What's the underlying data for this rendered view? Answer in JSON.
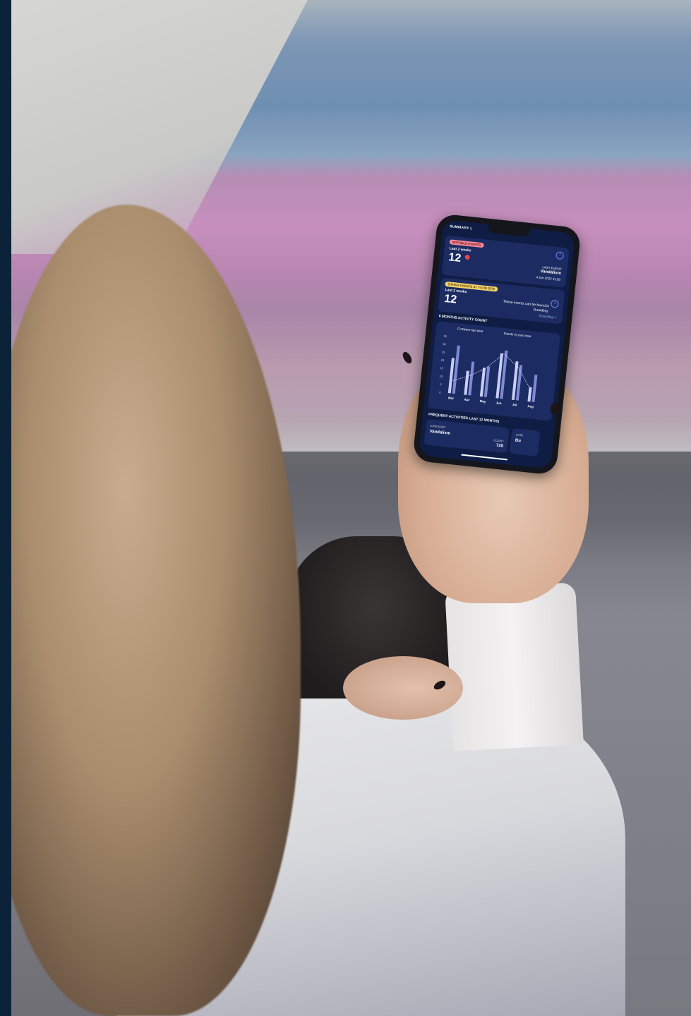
{
  "screen": {
    "summary_title": "SUMMARY L",
    "notable": {
      "badge": "NOTABLE EVENTS",
      "period": "Last 2 weeks",
      "count": "12",
      "last_event_label": "LAST EVENT",
      "last_event_value": "Vandalism",
      "last_event_time": "4 Jun 2022 21:50"
    },
    "other": {
      "badge": "OTHER EVENTS AT YOUR SITE",
      "period": "Last 2 weeks",
      "count": "12",
      "note": "These events can be found in Guarding.",
      "link": "Guarding >"
    },
    "chart_section_title": "6 MONTHS ACTIVITY COUNT",
    "legend": {
      "compare": "Compare last year",
      "events": "Events in your area"
    },
    "frequent_title": "FREQUENT ACTIVITIES LAST 12 MONTHS",
    "frequent": {
      "category_label": "CATEGORY",
      "category_value": "Vandalism",
      "count_label": "COUNT",
      "count_value": "728",
      "second_category_label": "CATE",
      "second_category_value": "Bu"
    }
  },
  "chart_data": {
    "type": "bar",
    "categories": [
      "Mar",
      "Apr",
      "May",
      "Jun",
      "Jul",
      "Aug"
    ],
    "series": [
      {
        "values": [
          22,
          15,
          18,
          28,
          24,
          9
        ]
      },
      {
        "values": [
          30,
          21,
          19,
          30,
          22,
          17
        ]
      }
    ],
    "line": [
      8,
      12,
      18,
      28,
      20,
      6
    ],
    "yticks": [
      35,
      30,
      25,
      20,
      15,
      10,
      5,
      0
    ],
    "ylim": [
      0,
      35
    ],
    "colors": {
      "bar_primary": "#c9cdf7",
      "bar_secondary": "#7f8bd6",
      "line": "#e5e7ff"
    }
  }
}
